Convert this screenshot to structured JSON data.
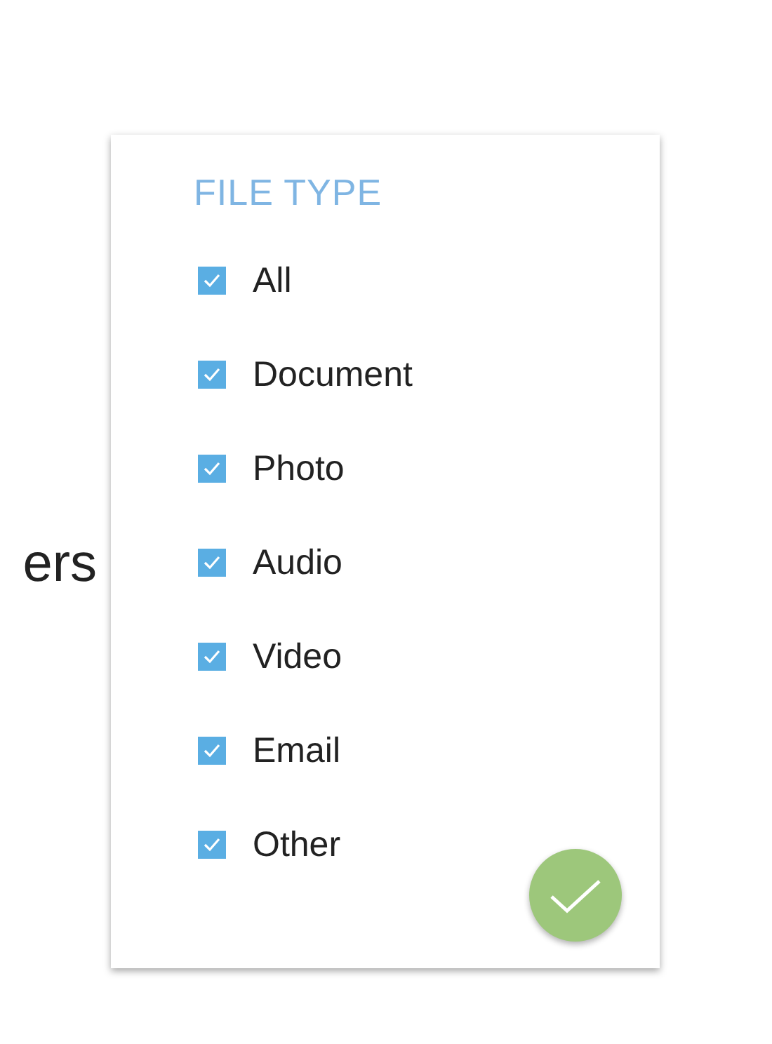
{
  "background_title": "ers",
  "filter_panel": {
    "heading": "FILE TYPE",
    "options": [
      {
        "label": "All",
        "checked": true
      },
      {
        "label": "Document",
        "checked": true
      },
      {
        "label": "Photo",
        "checked": true
      },
      {
        "label": "Audio",
        "checked": true
      },
      {
        "label": "Video",
        "checked": true
      },
      {
        "label": "Email",
        "checked": true
      },
      {
        "label": "Other",
        "checked": true
      }
    ]
  }
}
